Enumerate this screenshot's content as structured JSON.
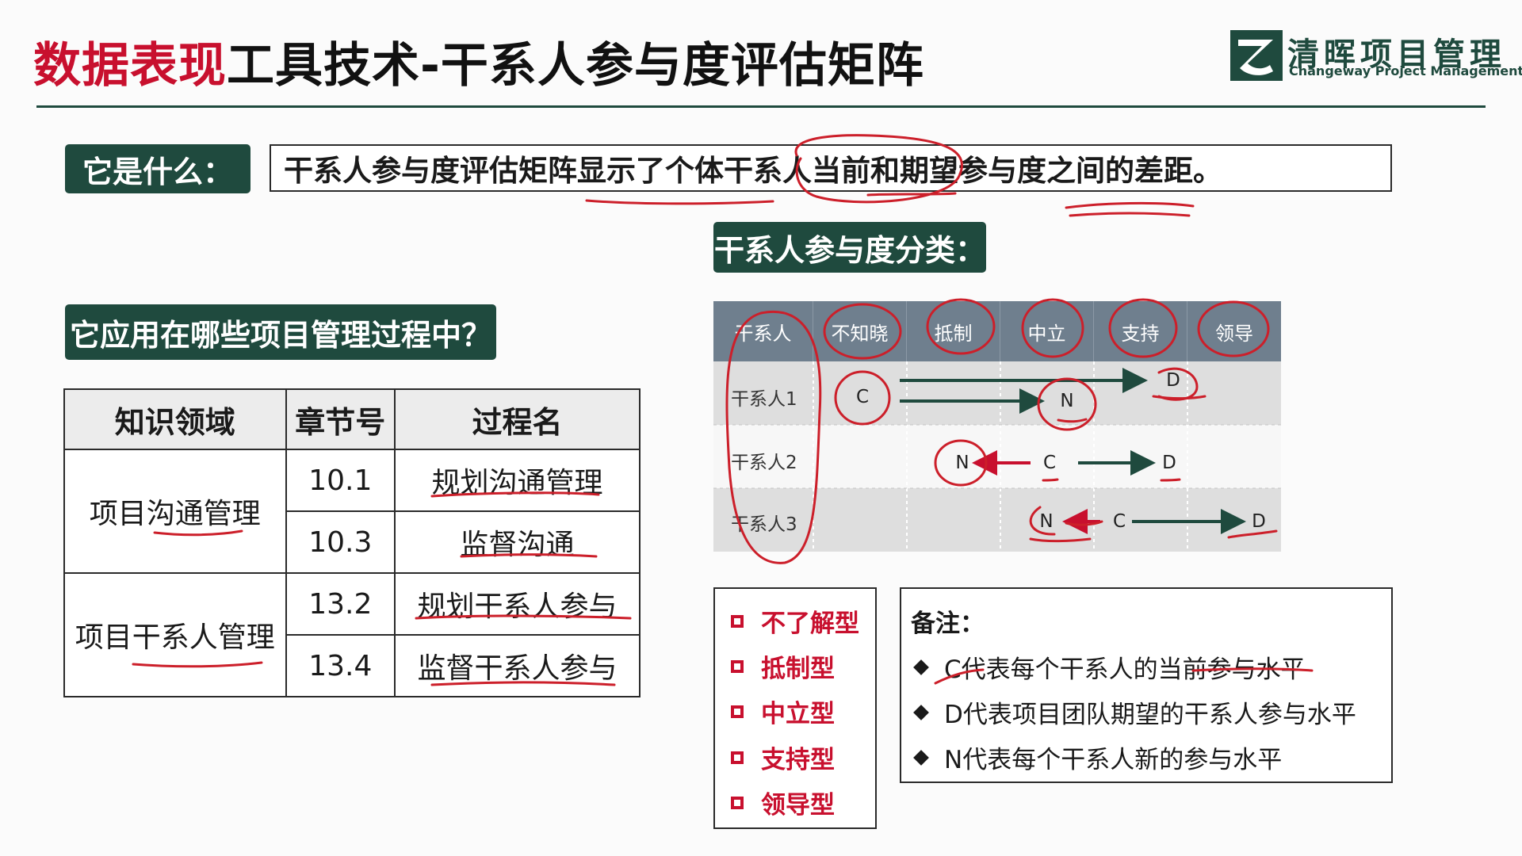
{
  "title": {
    "part_red": "数据表现",
    "part_dark": "工具技术-干系人参与度评估矩阵"
  },
  "logo": {
    "name_cn": "清晖项目管理",
    "name_en": "Changeway Project Management"
  },
  "what": {
    "label": "它是什么：",
    "definition": "干系人参与度评估矩阵显示了个体干系人当前和期望参与度之间的差距。"
  },
  "category_label": "干系人参与度分类：",
  "apply_label": "它应用在哪些项目管理过程中？",
  "process_table": {
    "headers": [
      "知识领域",
      "章节号",
      "过程名"
    ],
    "groups": [
      {
        "area": "项目沟通管理",
        "rows": [
          {
            "chapter": "10.1",
            "process": "规划沟通管理"
          },
          {
            "chapter": "10.3",
            "process": "监督沟通"
          }
        ]
      },
      {
        "area": "项目干系人管理",
        "rows": [
          {
            "chapter": "13.2",
            "process": "规划干系人参与"
          },
          {
            "chapter": "13.4",
            "process": "监督干系人参与"
          }
        ]
      }
    ]
  },
  "matrix": {
    "headers": [
      "干系人",
      "不知晓",
      "抵制",
      "中立",
      "支持",
      "领导"
    ],
    "rows": [
      {
        "name": "干系人1",
        "C": "C",
        "D": "D",
        "N": "N"
      },
      {
        "name": "干系人2",
        "C": "C",
        "D": "D",
        "N": "N"
      },
      {
        "name": "干系人3",
        "C": "C",
        "D": "D",
        "N": "N"
      }
    ]
  },
  "types": [
    "不了解型",
    "抵制型",
    "中立型",
    "支持型",
    "领导型"
  ],
  "notes": {
    "title": "备注：",
    "items": [
      "C代表每个干系人的当前参与水平",
      "D代表项目团队期望的干系人参与水平",
      "N代表每个干系人新的参与水平"
    ]
  },
  "colors": {
    "brand": "#1f4a3e",
    "accent_red": "#c8102e",
    "annotation": "#cc1f2a"
  },
  "icons": {
    "logo": "changeway-logo-icon",
    "type_bullet": "square-outline-icon",
    "note_bullet": "diamond-bullet-icon"
  }
}
